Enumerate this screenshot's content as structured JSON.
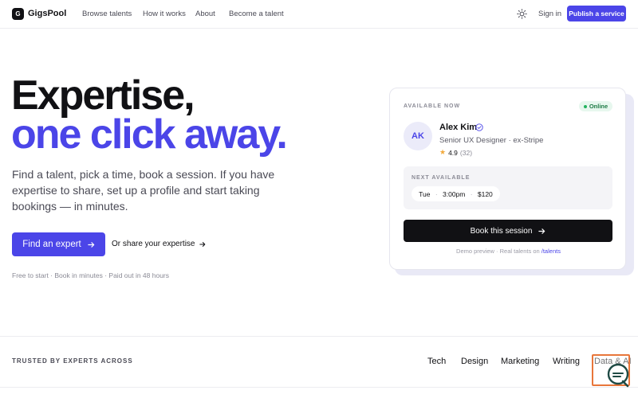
{
  "brand": {
    "logo_letter": "G",
    "name": "GigsPool"
  },
  "nav": {
    "links": [
      "Browse talents",
      "How it works",
      "About",
      "Become a talent"
    ],
    "signin": "Sign in",
    "publish": "Publish a service"
  },
  "hero": {
    "line1": "Expertise,",
    "line2": "one click away.",
    "subtitle": "Find a talent, pick a time, book a session. If you have expertise to share, set up a profile and start taking bookings — in minutes.",
    "cta_primary": "Find an expert",
    "cta_secondary": "Or share your expertise",
    "perks": "Free to start · Book in minutes · Paid out in 48 hours"
  },
  "card": {
    "available_label": "AVAILABLE NOW",
    "status": "Online",
    "avatar_initials": "AK",
    "name": "Alex Kim",
    "role": "Senior UX Designer · ex-Stripe",
    "rating": "4.9",
    "reviews": "(32)",
    "next_label": "NEXT AVAILABLE",
    "slot_day": "Tue",
    "slot_time": "3:00pm",
    "slot_price": "$120",
    "book_button": "Book this session",
    "demo_note": "Demo preview · Real talents on",
    "demo_link": "/talents"
  },
  "trusted": {
    "label": "TRUSTED BY EXPERTS ACROSS",
    "categories": [
      "Tech",
      "Design",
      "Marketing",
      "Writing",
      "Data & AI"
    ]
  },
  "icons": {
    "theme": "sun-icon",
    "arrow": "arrow-right-icon",
    "verified": "check-circle-icon",
    "star": "star-icon",
    "help": "chat-help-icon"
  },
  "colors": {
    "accent": "#4b45e8",
    "dark": "#111114",
    "online": "#22b35e",
    "star": "#f2a93b"
  }
}
